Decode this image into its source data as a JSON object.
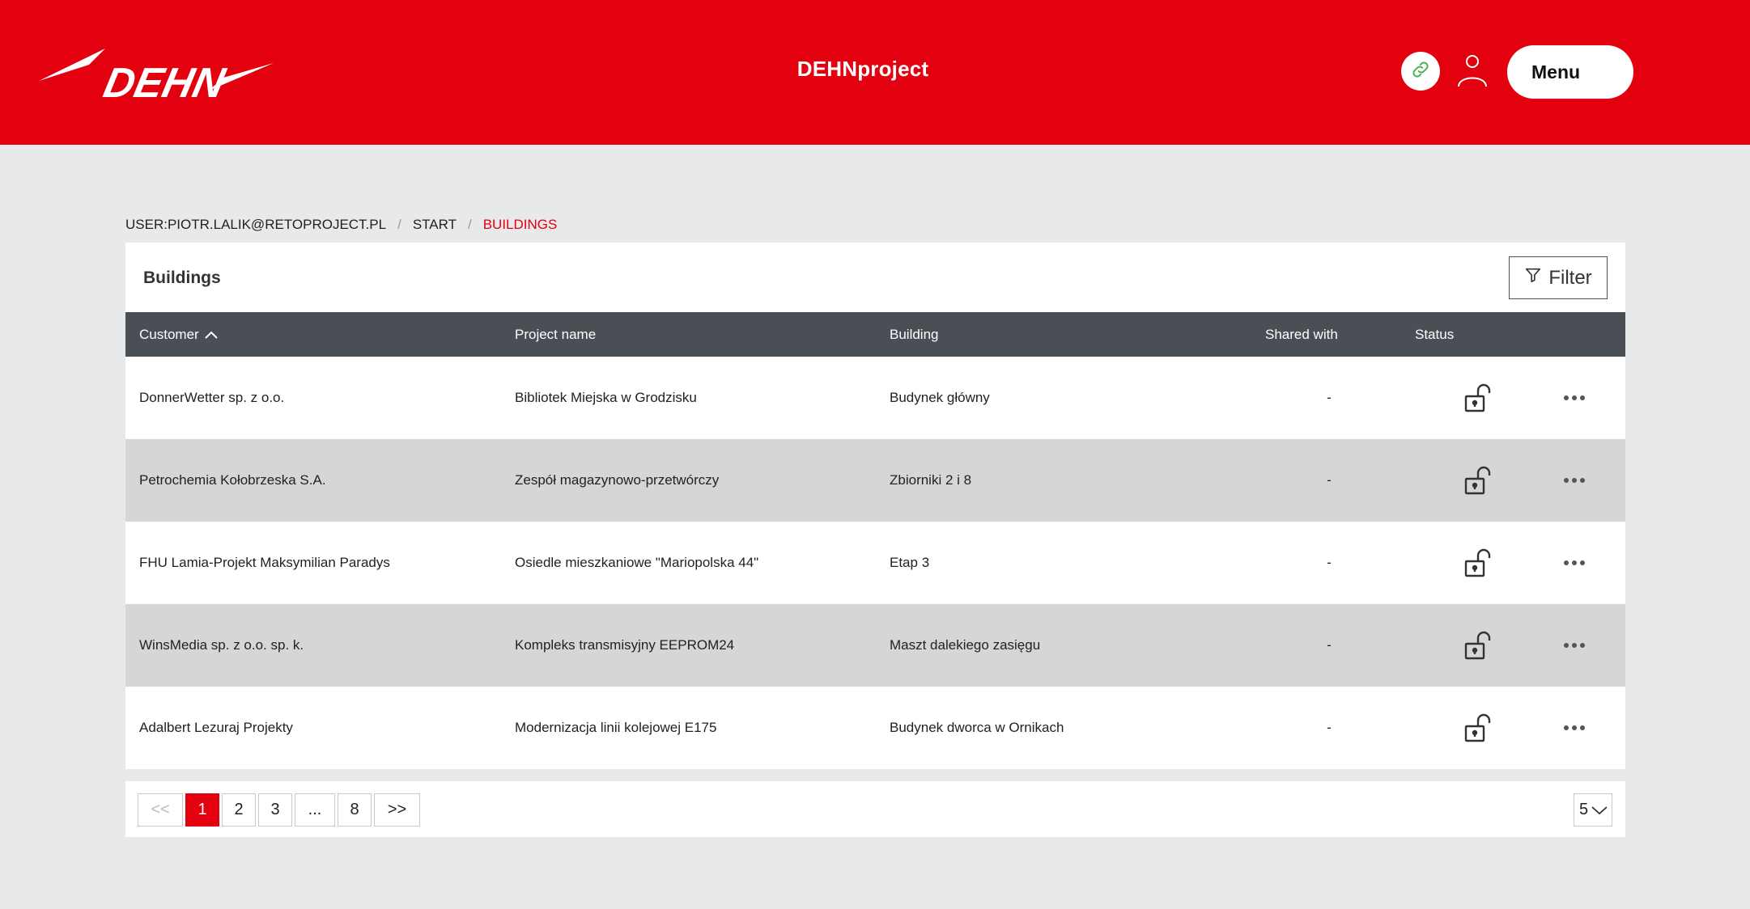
{
  "header": {
    "logo_text": "DEHN",
    "app_title": "DEHNproject",
    "menu_label": "Menu",
    "brand_color": "#e3000f"
  },
  "breadcrumb": {
    "user": "USER:PIOTR.LALIK@RETOPROJECT.PL",
    "start": "START",
    "current": "BUILDINGS"
  },
  "panel": {
    "title": "Buildings",
    "filter_label": "Filter"
  },
  "table": {
    "columns": {
      "customer": "Customer",
      "project": "Project name",
      "building": "Building",
      "shared": "Shared with",
      "status": "Status"
    },
    "sort_icon": "chevron-up-icon",
    "rows": [
      {
        "customer": "DonnerWetter sp. z o.o.",
        "project": "Bibliotek Miejska w Grodzisku",
        "building": "Budynek główny",
        "shared": "-",
        "status": "unlocked"
      },
      {
        "customer": "Petrochemia Kołobrzeska S.A.",
        "project": "Zespół magazynowo-przetwórczy",
        "building": "Zbiorniki 2 i 8",
        "shared": "-",
        "status": "unlocked"
      },
      {
        "customer": "FHU Lamia-Projekt Maksymilian Paradys",
        "project": "Osiedle mieszkaniowe \"Mariopolska 44\"",
        "building": "Etap 3",
        "shared": "-",
        "status": "unlocked"
      },
      {
        "customer": "WinsMedia sp. z o.o. sp. k.",
        "project": "Kompleks transmisyjny EEPROM24",
        "building": "Maszt dalekiego zasięgu",
        "shared": "-",
        "status": "unlocked"
      },
      {
        "customer": "Adalbert Lezuraj Projekty",
        "project": "Modernizacja linii kolejowej E175",
        "building": "Budynek dworca w Ornikach",
        "shared": "-",
        "status": "unlocked"
      }
    ]
  },
  "pagination": {
    "prev": "<<",
    "pages": [
      "1",
      "2",
      "3",
      "...",
      "8"
    ],
    "next": ">>",
    "current": "1",
    "page_size": "5"
  }
}
